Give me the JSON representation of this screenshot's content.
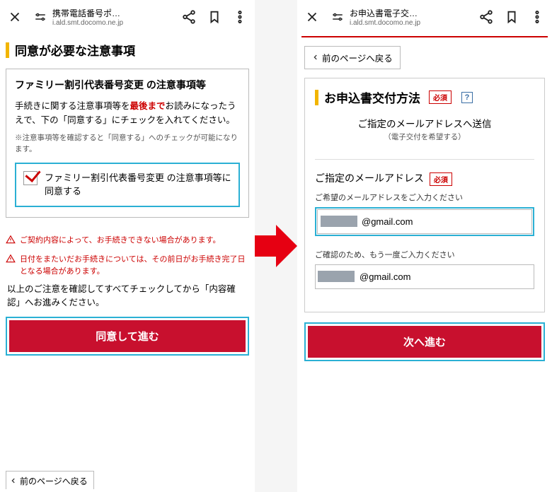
{
  "left": {
    "topbar": {
      "title": "携帯電話番号ポ…",
      "url": "i.ald.smt.docomo.ne.jp"
    },
    "section_title": "同意が必要な注意事項",
    "sub_title": "ファミリー割引代表番号変更 の注意事項等",
    "body_pre": "手続きに関する注意事項等を",
    "body_red": "最後まで",
    "body_post": "お読みになったうえで、下の「同意する」にチェックを入れてください。",
    "body_tiny": "※注意事項等を確認すると「同意する」へのチェックが可能になります。",
    "checkbox_label": "ファミリー割引代表番号変更 の注意事項等に同意する",
    "warn1": "ご契約内容によって、お手続きできない場合があります。",
    "warn2": "日付をまたいだお手続きについては、その前日がお手続き完了日となる場合があります。",
    "note": "以上のご注意を確認してすべてチェックしてから「内容確認」へお進みください。",
    "cta": "同意して進む",
    "back_partial": "前のページへ戻る"
  },
  "right": {
    "topbar": {
      "title": "お申込書電子交…",
      "url": "i.ald.smt.docomo.ne.jp"
    },
    "back": "前のページへ戻る",
    "section_title": "お申込書交付方法",
    "required": "必須",
    "method": "ご指定のメールアドレスへ送信",
    "method_sub": "（電子交付を希望する）",
    "email_title": "ご指定のメールアドレス",
    "hint1": "ご希望のメールアドレスをご入力ください",
    "hint2": "ご確認のため、もう一度ご入力ください",
    "email_value": "@gmail.com",
    "cta": "次へ進む"
  }
}
